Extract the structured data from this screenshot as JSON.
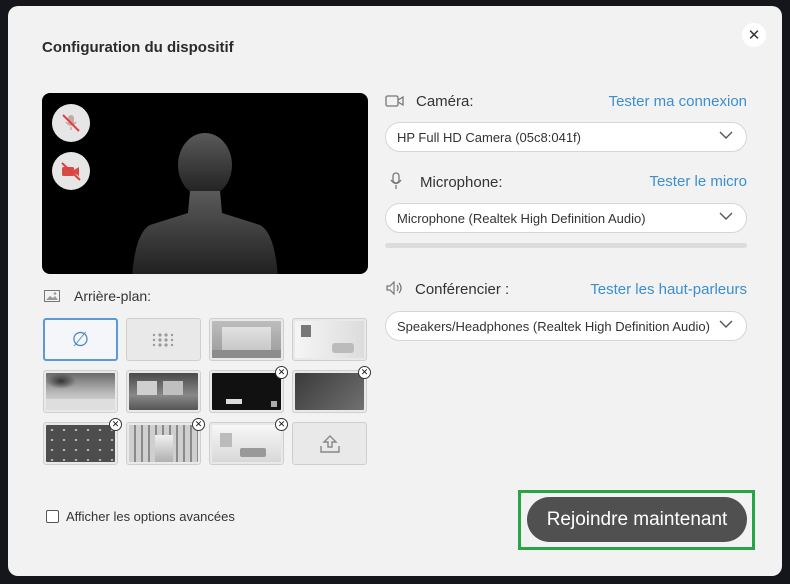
{
  "dialog": {
    "title": "Configuration du dispositif",
    "close_icon": "close-icon"
  },
  "preview": {
    "mic_state": "muted",
    "camera_state": "off"
  },
  "background": {
    "label": "Arrière-plan:",
    "thumbnails": [
      {
        "name": "none",
        "selected": true,
        "removable": false
      },
      {
        "name": "blur",
        "selected": false,
        "removable": false
      },
      {
        "name": "empty-room",
        "selected": false,
        "removable": false
      },
      {
        "name": "white-office",
        "selected": false,
        "removable": false
      },
      {
        "name": "beach-palms",
        "selected": false,
        "removable": false
      },
      {
        "name": "window-view",
        "selected": false,
        "removable": false
      },
      {
        "name": "dark-branded",
        "selected": false,
        "removable": true
      },
      {
        "name": "grey-pattern",
        "selected": false,
        "removable": true
      },
      {
        "name": "logo-pattern",
        "selected": false,
        "removable": true
      },
      {
        "name": "library",
        "selected": false,
        "removable": true
      },
      {
        "name": "white-living-room",
        "selected": false,
        "removable": true
      },
      {
        "name": "upload",
        "selected": false,
        "removable": false
      }
    ]
  },
  "camera": {
    "label": "Caméra:",
    "test_link": "Tester ma connexion",
    "selected": "HP Full HD Camera (05c8:041f)"
  },
  "microphone": {
    "label": "Microphone:",
    "test_link": "Tester le micro",
    "selected": "Microphone (Realtek High Definition Audio)",
    "level": 0
  },
  "speaker": {
    "label": "Conférencier :",
    "test_link": "Tester les haut-parleurs",
    "selected": "Speakers/Headphones (Realtek High Definition Audio)"
  },
  "footer": {
    "advanced_label": "Afficher les options avancées",
    "advanced_checked": false,
    "join_label": "Rejoindre maintenant"
  },
  "colors": {
    "link": "#3b8fd1",
    "join_button": "#505050",
    "highlight": "#27a547",
    "selected_border": "#5b9bd5"
  }
}
